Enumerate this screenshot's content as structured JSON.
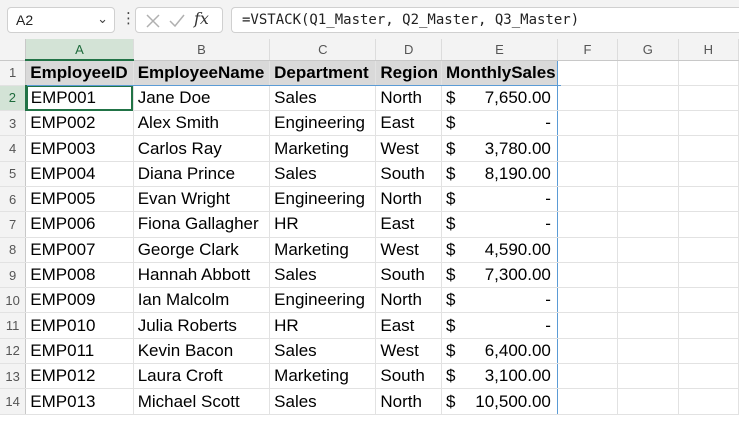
{
  "name_box": {
    "value": "A2"
  },
  "formula_bar": {
    "formula": "=VSTACK(Q1_Master, Q2_Master, Q3_Master)"
  },
  "columns": [
    "A",
    "B",
    "C",
    "D",
    "E",
    "F",
    "G",
    "H"
  ],
  "rows": [
    {
      "num": "1",
      "cells": [
        "EmployeeID",
        "EmployeeName",
        "Department",
        "Region",
        "MonthlySales"
      ]
    },
    {
      "num": "2",
      "cells": [
        "EMP001",
        "Jane Doe",
        "Sales",
        "North",
        "$",
        "7,650.00"
      ]
    },
    {
      "num": "3",
      "cells": [
        "EMP002",
        "Alex Smith",
        "Engineering",
        "East",
        "$",
        "-"
      ]
    },
    {
      "num": "4",
      "cells": [
        "EMP003",
        "Carlos Ray",
        "Marketing",
        "West",
        "$",
        "3,780.00"
      ]
    },
    {
      "num": "5",
      "cells": [
        "EMP004",
        "Diana Prince",
        "Sales",
        "South",
        "$",
        "8,190.00"
      ]
    },
    {
      "num": "6",
      "cells": [
        "EMP005",
        "Evan Wright",
        "Engineering",
        "North",
        "$",
        "-"
      ]
    },
    {
      "num": "7",
      "cells": [
        "EMP006",
        "Fiona Gallagher",
        "HR",
        "East",
        "$",
        "-"
      ]
    },
    {
      "num": "8",
      "cells": [
        "EMP007",
        "George Clark",
        "Marketing",
        "West",
        "$",
        "4,590.00"
      ]
    },
    {
      "num": "9",
      "cells": [
        "EMP008",
        "Hannah Abbott",
        "Sales",
        "South",
        "$",
        "7,300.00"
      ]
    },
    {
      "num": "10",
      "cells": [
        "EMP009",
        "Ian Malcolm",
        "Engineering",
        "North",
        "$",
        "-"
      ]
    },
    {
      "num": "11",
      "cells": [
        "EMP010",
        "Julia Roberts",
        "HR",
        "East",
        "$",
        "-"
      ]
    },
    {
      "num": "12",
      "cells": [
        "EMP011",
        "Kevin Bacon",
        "Sales",
        "West",
        "$",
        "6,400.00"
      ]
    },
    {
      "num": "13",
      "cells": [
        "EMP012",
        "Laura Croft",
        "Marketing",
        "South",
        "$",
        "3,100.00"
      ]
    },
    {
      "num": "14",
      "cells": [
        "EMP013",
        "Michael Scott",
        "Sales",
        "North",
        "$",
        "10,500.00"
      ]
    }
  ],
  "colors": {
    "selection": "#217346",
    "header_fill": "#d9d9d9",
    "spill_border": "#5b9bd5"
  }
}
